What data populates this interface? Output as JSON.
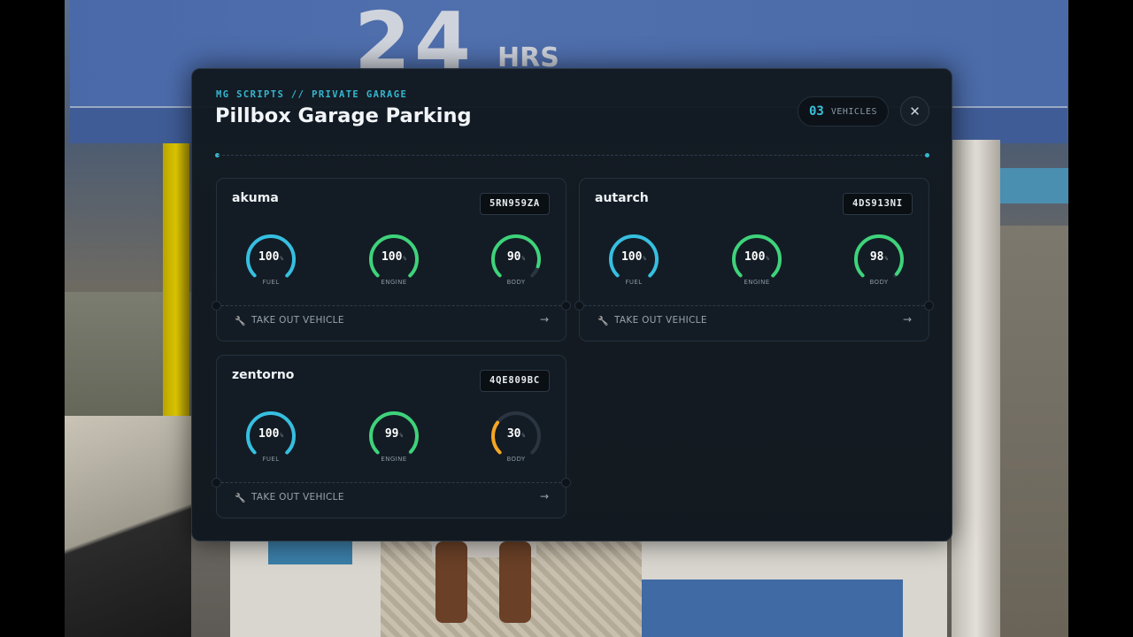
{
  "background": {
    "sign_number": "24",
    "sign_suffix": "HRS"
  },
  "header": {
    "subtitle": "MG SCRIPTS // PRIVATE GARAGE",
    "title": "Pillbox Garage Parking",
    "vehicle_count": "03",
    "vehicle_count_label": "VEHICLES",
    "close_icon": "close-icon"
  },
  "colors": {
    "accent": "#37b6cf",
    "fuel": "#36bfe0",
    "engine": "#3ed37a",
    "body_ok": "#3ed37a",
    "body_low": "#f5a623",
    "track": "#2a3541"
  },
  "gauge_labels": {
    "fuel": "FUEL",
    "engine": "ENGINE",
    "body": "BODY"
  },
  "take_out_label": "TAKE OUT VEHICLE",
  "vehicles": [
    {
      "name": "akuma",
      "plate": "5RN959ZA",
      "fuel": 100,
      "engine": 100,
      "body": 90
    },
    {
      "name": "autarch",
      "plate": "4DS913NI",
      "fuel": 100,
      "engine": 100,
      "body": 98
    },
    {
      "name": "zentorno",
      "plate": "4QE809BC",
      "fuel": 100,
      "engine": 99,
      "body": 30
    }
  ]
}
